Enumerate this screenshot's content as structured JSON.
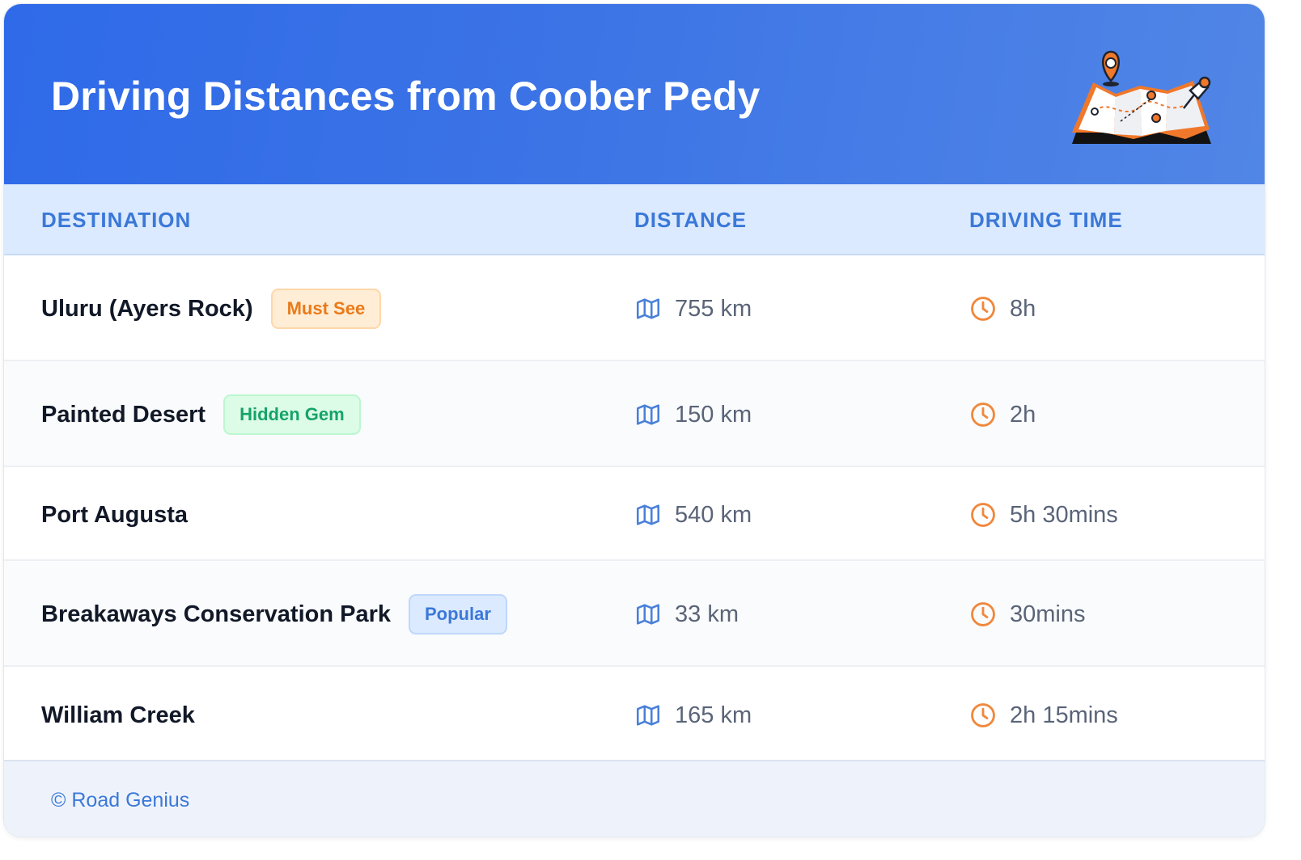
{
  "header": {
    "title": "Driving Distances from Coober Pedy",
    "illustration_icon": "folded-map-with-location-pin-icon",
    "gradient_start": "#2f6ae8",
    "gradient_end": "#5186e6"
  },
  "table": {
    "columns": {
      "destination": "DESTINATION",
      "distance": "DISTANCE",
      "driving_time": "DRIVING TIME"
    },
    "distance_icon": "map-icon",
    "time_icon": "clock-icon",
    "rows": [
      {
        "destination": "Uluru (Ayers Rock)",
        "badge": "Must See",
        "badge_color": "#ea7a1a",
        "distance": "755 km",
        "time": "8h"
      },
      {
        "destination": "Painted Desert",
        "badge": "Hidden Gem",
        "badge_color": "#16a36a",
        "distance": "150 km",
        "time": "2h"
      },
      {
        "destination": "Port Augusta",
        "distance": "540 km",
        "time": "5h 30mins"
      },
      {
        "destination": "Breakaways Conservation Park",
        "badge": "Popular",
        "badge_color": "#3b78d8",
        "distance": "33 km",
        "time": "30mins"
      },
      {
        "destination": "William Creek",
        "distance": "165 km",
        "time": "2h 15mins"
      }
    ]
  },
  "footer": {
    "credit": "© Road Genius"
  }
}
